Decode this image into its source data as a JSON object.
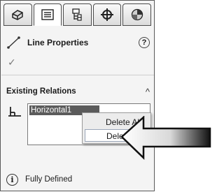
{
  "tabs": [
    {
      "name": "feature-manager",
      "icon": "feature-tree-icon"
    },
    {
      "name": "property-manager",
      "icon": "property-manager-icon",
      "active": true
    },
    {
      "name": "configuration-manager",
      "icon": "configuration-manager-icon"
    },
    {
      "name": "dimxpert-manager",
      "icon": "crosshair-icon"
    },
    {
      "name": "display-manager",
      "icon": "appearance-sphere-icon"
    }
  ],
  "header": {
    "title": "Line Properties",
    "help_symbol": "?"
  },
  "confirm_symbol": "✓",
  "existing_relations": {
    "label": "Existing Relations",
    "collapse_symbol": "^",
    "items": [
      "Horizontal1"
    ]
  },
  "context_menu": {
    "items": [
      "Delete All",
      "Delete"
    ],
    "highlighted": "Delete"
  },
  "status": {
    "icon_letter": "i",
    "text": "Fully Defined"
  },
  "colors": {
    "panel_bg": "#f4f4f4",
    "selection_bg": "#5b5b5b"
  }
}
